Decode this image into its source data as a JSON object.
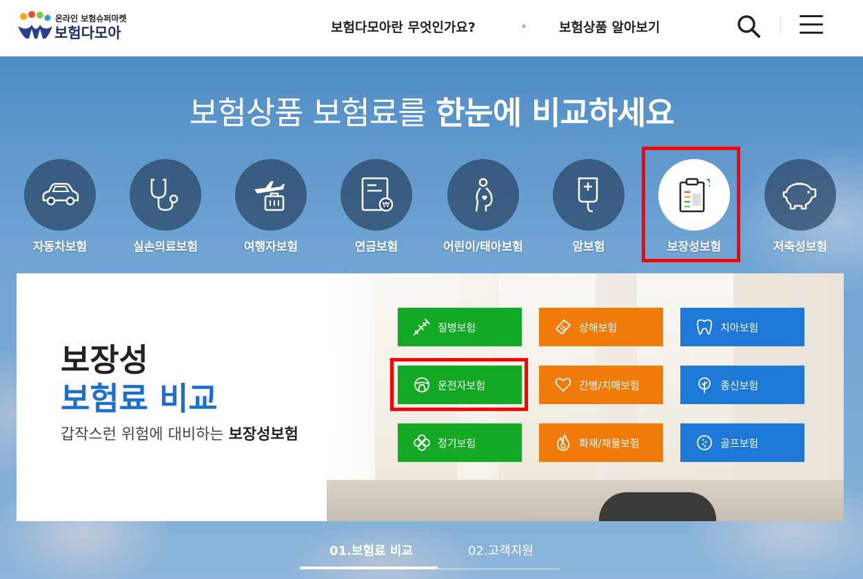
{
  "header": {
    "logo_sub": "온라인 보험슈퍼마켓",
    "logo_main": "보험다모아",
    "nav": [
      "보험다모아란 무엇인가요?",
      "보험상품 알아보기"
    ],
    "icons": [
      "search-icon",
      "hamburger-menu-icon"
    ]
  },
  "hero": {
    "title_light": "보험상품 보험료를",
    "title_bold": "한눈에 비교하세요"
  },
  "categories": [
    {
      "label": "자동차보험",
      "icon": "car-icon"
    },
    {
      "label": "실손의료보험",
      "icon": "stethoscope-icon"
    },
    {
      "label": "여행자보험",
      "icon": "airplane-luggage-icon"
    },
    {
      "label": "연금보험",
      "icon": "pension-document-icon"
    },
    {
      "label": "어린이/태아보험",
      "icon": "pregnant-mother-icon"
    },
    {
      "label": "암보험",
      "icon": "iv-drip-icon"
    },
    {
      "label": "보장성보험",
      "icon": "clipboard-icon",
      "active": true
    },
    {
      "label": "저축성보험",
      "icon": "piggy-bank-icon"
    }
  ],
  "panel": {
    "heading_line1": "보장성",
    "heading_line2": "보험료 비교",
    "desc_light": "갑작스런 위험에 대비하는",
    "desc_bold": "보장성보험",
    "buttons": [
      {
        "label": "질병보험",
        "color": "green",
        "icon": "syringe-icon"
      },
      {
        "label": "상해보험",
        "color": "orange",
        "icon": "bandage-icon"
      },
      {
        "label": "치아보험",
        "color": "blue",
        "icon": "tooth-icon"
      },
      {
        "label": "운전자보험",
        "color": "green",
        "icon": "steering-wheel-icon",
        "highlighted": true
      },
      {
        "label": "간병/치매보험",
        "color": "orange",
        "icon": "heart-icon"
      },
      {
        "label": "종신보험",
        "color": "blue",
        "icon": "tree-icon"
      },
      {
        "label": "정기보험",
        "color": "green",
        "icon": "clover-icon"
      },
      {
        "label": "화재/재물보험",
        "color": "orange",
        "icon": "fire-icon"
      },
      {
        "label": "골프보험",
        "color": "blue",
        "icon": "golf-ball-icon"
      }
    ]
  },
  "tabs": [
    "01.보험료 비교",
    "02.고객지원"
  ],
  "colors": {
    "green": "#13a924",
    "orange": "#f07a0a",
    "blue": "#1e78d8",
    "accent_blue": "#1a6fd1",
    "highlight": "#ff0000"
  }
}
